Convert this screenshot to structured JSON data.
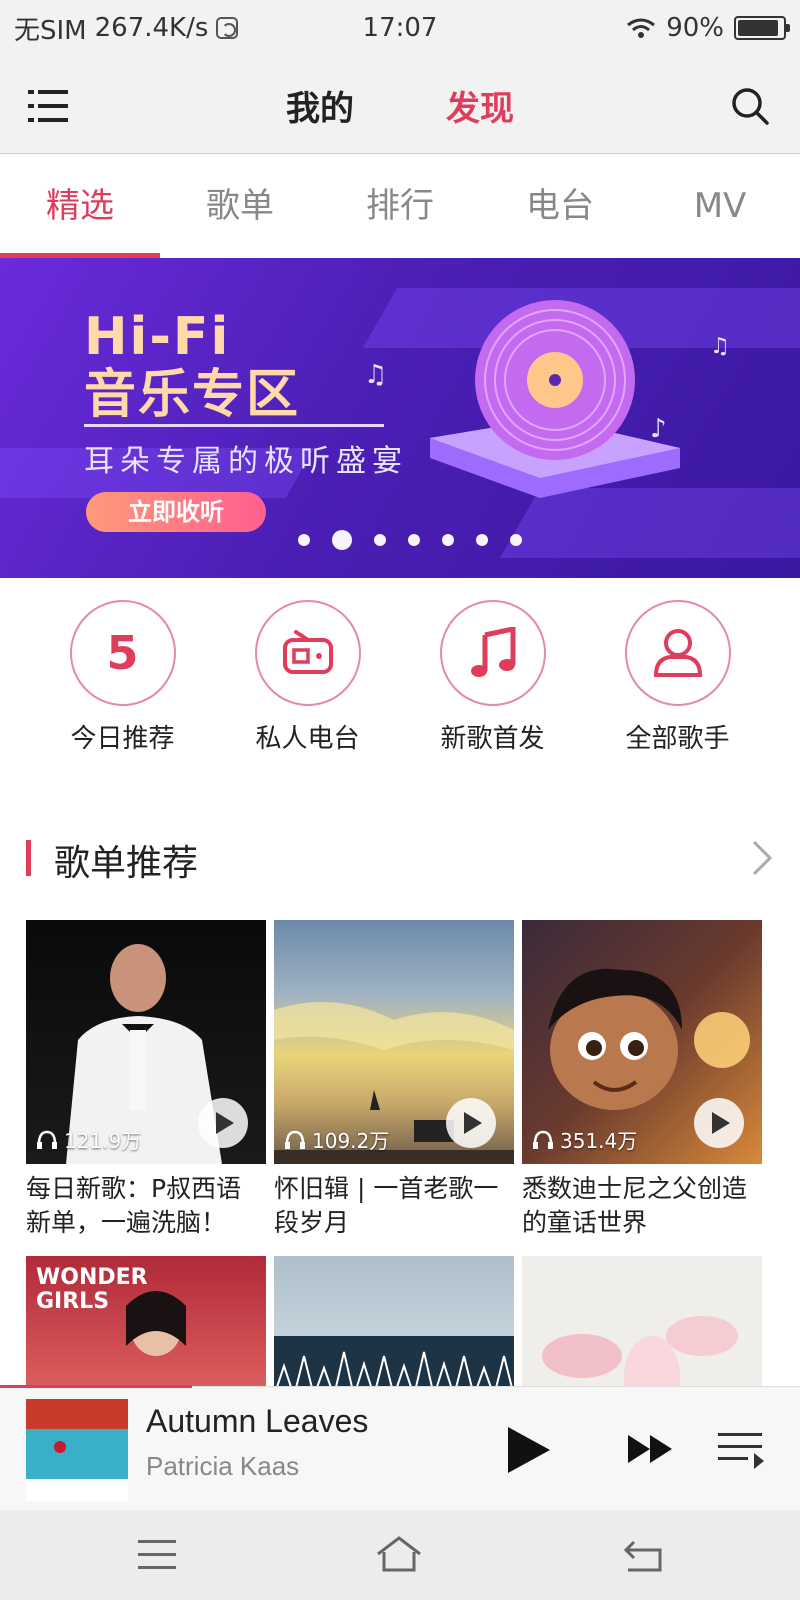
{
  "status_bar": {
    "carrier": "无SIM",
    "speed": "267.4K/s",
    "time": "17:07",
    "battery_text": "90%",
    "battery_level": 0.9
  },
  "top_nav": {
    "tabs": [
      {
        "label": "我的",
        "active": false
      },
      {
        "label": "发现",
        "active": true
      }
    ]
  },
  "sub_tabs": [
    {
      "label": "精选",
      "active": true
    },
    {
      "label": "歌单",
      "active": false
    },
    {
      "label": "排行",
      "active": false
    },
    {
      "label": "电台",
      "active": false
    },
    {
      "label": "MV",
      "active": false
    }
  ],
  "banner": {
    "title_line1": "Hi-Fi",
    "title_line2": "音乐专区",
    "subtitle": "耳朵专属的极听盛宴",
    "cta": "立即收听",
    "dots_count": 7,
    "active_dot": 1
  },
  "quick_entries": [
    {
      "label": "今日推荐",
      "icon": "calendar-number-icon",
      "number": "5"
    },
    {
      "label": "私人电台",
      "icon": "radio-icon"
    },
    {
      "label": "新歌首发",
      "icon": "music-note-icon"
    },
    {
      "label": "全部歌手",
      "icon": "singer-icon"
    }
  ],
  "section": {
    "title": "歌单推荐"
  },
  "playlists": [
    {
      "title": "每日新歌：P叔西语新单，一遍洗脑！",
      "plays": "121.9万"
    },
    {
      "title": "怀旧辑 | 一首老歌一段岁月",
      "plays": "109.2万"
    },
    {
      "title": "悉数迪士尼之父创造的童话世界",
      "plays": "351.4万"
    },
    {
      "title": "",
      "plays": ""
    },
    {
      "title": "",
      "plays": ""
    },
    {
      "title": "",
      "plays": ""
    }
  ],
  "player": {
    "song": "Autumn Leaves",
    "artist": "Patricia Kaas",
    "progress": 0.24
  },
  "colors": {
    "accent": "#e03c5c",
    "banner_bg": "#4b1fb5"
  }
}
